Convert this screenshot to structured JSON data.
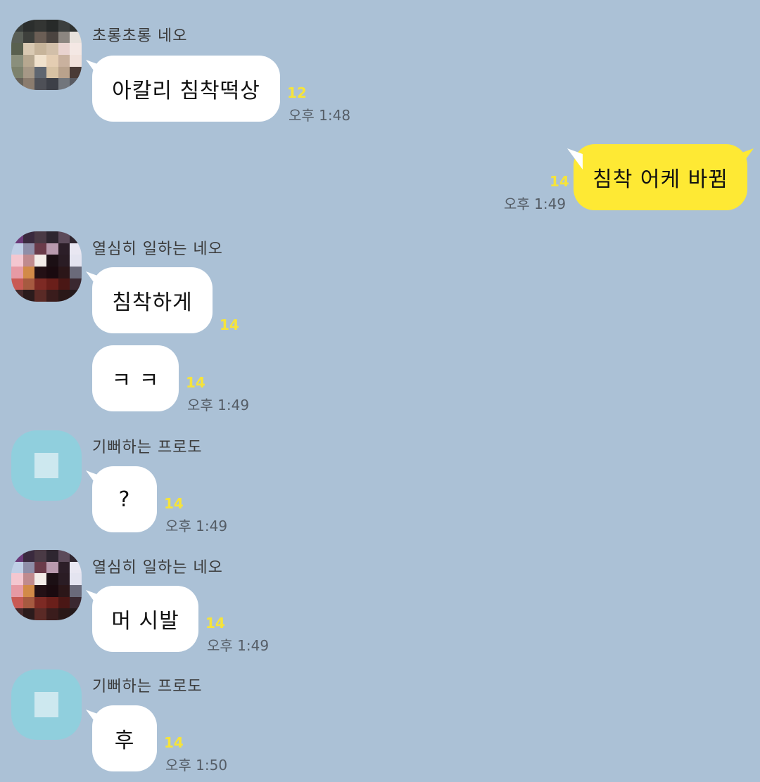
{
  "messages": [
    {
      "sender": "초롱초롱 네오",
      "text": "아칼리 침착떡상",
      "unread": "12",
      "time": "오후 1:48"
    },
    {
      "sender": "me",
      "text": "침착 어케 바뀜",
      "unread": "14",
      "time": "오후 1:49"
    },
    {
      "sender": "열심히 일하는 네오",
      "text": "침착하게",
      "unread": "14",
      "time": ""
    },
    {
      "sender": "열심히 일하는 네오",
      "text": "ㅋ ㅋ",
      "unread": "14",
      "time": "오후 1:49"
    },
    {
      "sender": "기뻐하는 프로도",
      "text": "?",
      "unread": "14",
      "time": "오후 1:49"
    },
    {
      "sender": "열심히 일하는 네오",
      "text": "머 시발",
      "unread": "14",
      "time": "오후 1:49"
    },
    {
      "sender": "기뻐하는 프로도",
      "text": "후",
      "unread": "14",
      "time": "오후 1:50"
    }
  ],
  "colors": {
    "background": "#abc1d6",
    "my_bubble": "#fee934",
    "other_bubble": "#ffffff",
    "unread": "#f6e43a"
  }
}
